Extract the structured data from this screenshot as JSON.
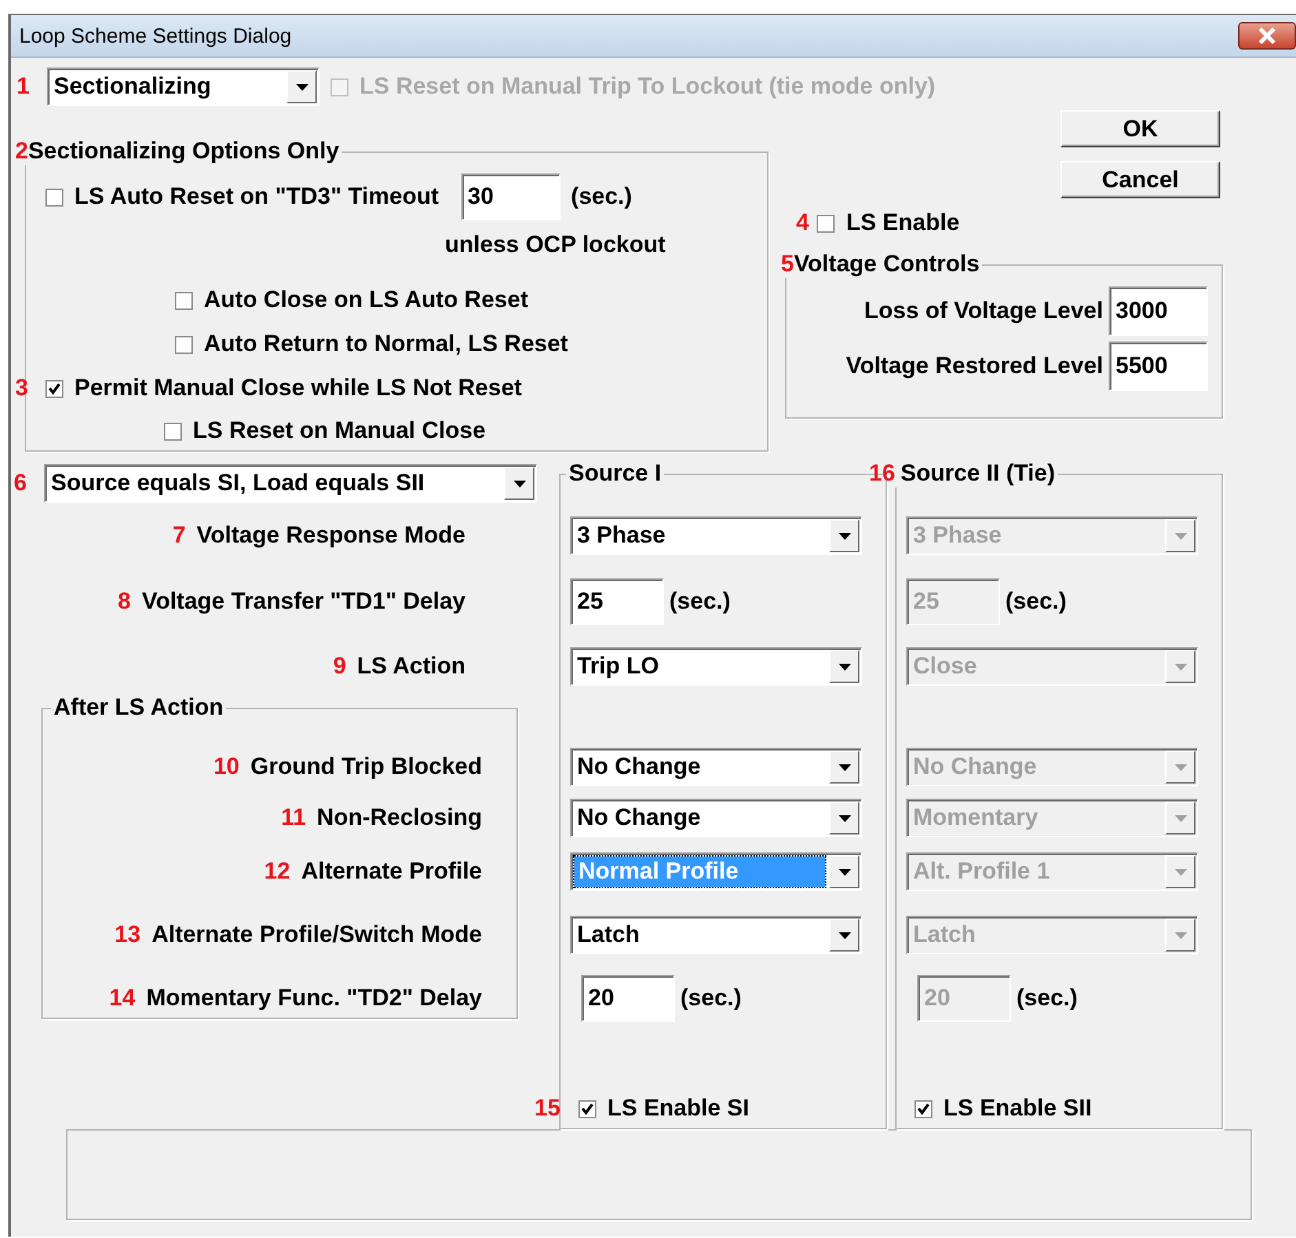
{
  "window": {
    "title": "Loop Scheme Settings Dialog"
  },
  "mode": {
    "marker": "1",
    "value": "Sectionalizing"
  },
  "tie_reset": {
    "label": "LS Reset on Manual Trip To Lockout  (tie mode only)",
    "checked": false,
    "disabled": true
  },
  "sectionalizing": {
    "marker": "2",
    "title": "Sectionalizing Options Only",
    "auto_reset": {
      "label": "LS Auto Reset on \"TD3\" Timeout",
      "checked": false,
      "value": "30",
      "unit": "(sec.)",
      "note": "unless OCP lockout"
    },
    "options": [
      {
        "kind": "sub",
        "label": "Auto Close on LS Auto Reset",
        "checked": false
      },
      {
        "kind": "sub",
        "label": "Auto Return to Normal, LS Reset",
        "checked": false
      },
      {
        "kind": "main",
        "marker": "3",
        "label": "Permit Manual Close while LS Not Reset",
        "checked": true
      },
      {
        "kind": "minor",
        "label": "LS Reset on Manual Close",
        "checked": false
      }
    ]
  },
  "buttons": [
    "OK",
    "Cancel"
  ],
  "ls_enable": {
    "marker": "4",
    "label": "LS Enable",
    "checked": false
  },
  "voltage_controls": {
    "marker": "5",
    "title": "Voltage Controls",
    "fields": [
      {
        "label": "Loss of Voltage Level",
        "value": "3000"
      },
      {
        "label": "Voltage Restored Level",
        "value": "5500"
      }
    ]
  },
  "source_mode": {
    "marker": "6",
    "value": "Source equals SI, Load equals SII"
  },
  "sources": [
    {
      "title": "Source I",
      "disabled": false,
      "enable": {
        "marker": "15",
        "label": "LS Enable SI",
        "checked": true
      }
    },
    {
      "marker": "16",
      "title": "Source II (Tie)",
      "disabled": true,
      "enable": {
        "label": "LS Enable SII",
        "checked": true
      }
    }
  ],
  "rows": [
    {
      "marker": "7",
      "label": "Voltage Response Mode",
      "kind": "select",
      "values": [
        {
          "text": "3 Phase",
          "focused": false
        },
        {
          "text": "3 Phase",
          "focused": false
        }
      ]
    },
    {
      "marker": "8",
      "label": "Voltage Transfer \"TD1\" Delay",
      "kind": "number",
      "values": [
        {
          "text": "25",
          "unit": "(sec.)",
          "focused": false
        },
        {
          "text": "25",
          "unit": "(sec.)",
          "focused": false
        }
      ]
    },
    {
      "marker": "9",
      "label": "LS Action",
      "kind": "select",
      "values": [
        {
          "text": "Trip LO",
          "focused": false
        },
        {
          "text": "Close",
          "focused": false
        }
      ]
    }
  ],
  "after_group": {
    "title": "After LS Action",
    "rows": [
      {
        "marker": "10",
        "label": "Ground Trip Blocked",
        "kind": "select",
        "values": [
          {
            "text": "No Change",
            "focused": false
          },
          {
            "text": "No Change",
            "focused": false
          }
        ]
      },
      {
        "marker": "11",
        "label": "Non-Reclosing",
        "kind": "select",
        "values": [
          {
            "text": "No Change",
            "focused": false
          },
          {
            "text": "Momentary",
            "focused": false
          }
        ]
      },
      {
        "marker": "12",
        "label": "Alternate Profile",
        "kind": "select",
        "values": [
          {
            "text": "Normal Profile",
            "focused": true
          },
          {
            "text": "Alt. Profile 1",
            "focused": false
          }
        ]
      },
      {
        "marker": "13",
        "label": "Alternate Profile/Switch Mode",
        "kind": "select",
        "values": [
          {
            "text": "Latch",
            "focused": false
          },
          {
            "text": "Latch",
            "focused": false
          }
        ]
      },
      {
        "marker": "14",
        "label": "Momentary Func. \"TD2\" Delay",
        "kind": "number",
        "values": [
          {
            "text": "20",
            "unit": "(sec.)",
            "focused": false
          },
          {
            "text": "20",
            "unit": "(sec.)",
            "focused": false
          }
        ]
      }
    ]
  }
}
